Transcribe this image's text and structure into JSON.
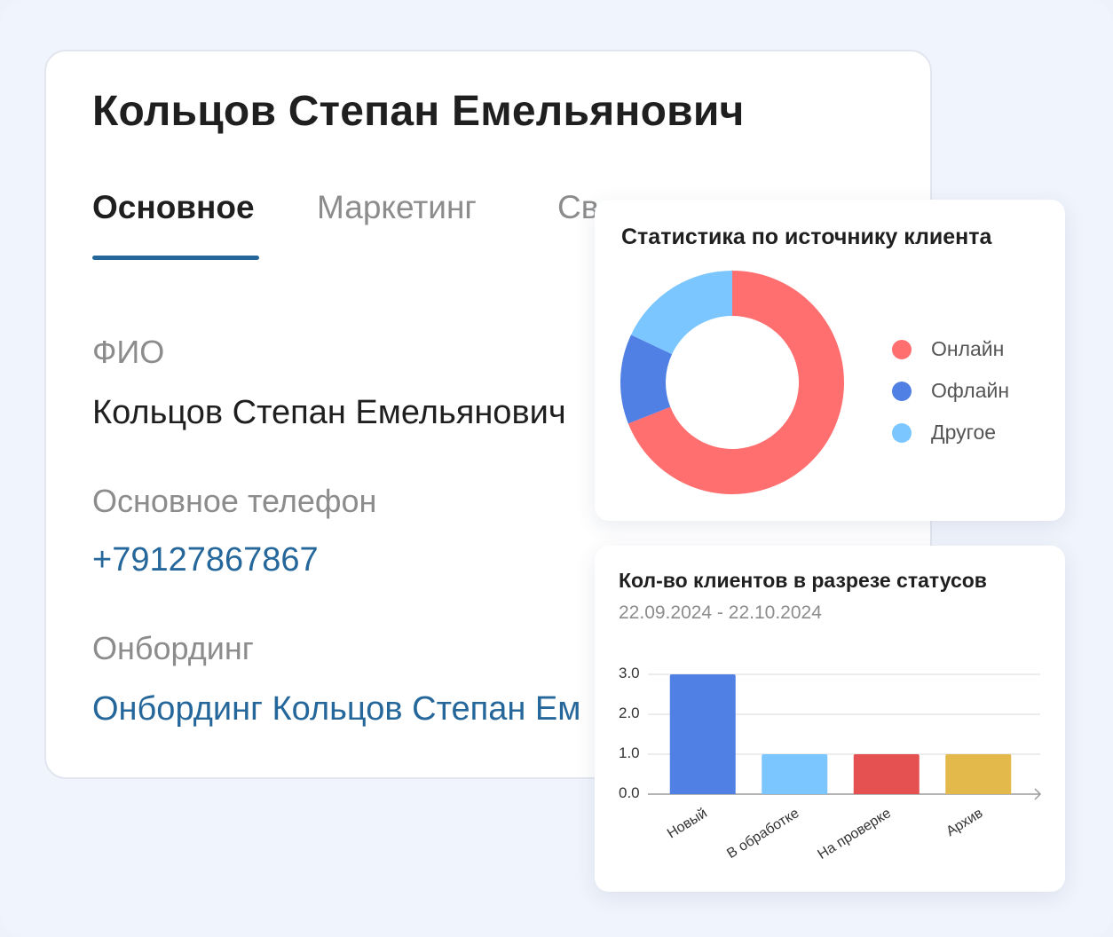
{
  "client": {
    "name": "Кольцов Степан Емельянович"
  },
  "tabs": [
    {
      "label": "Основное",
      "active": true
    },
    {
      "label": "Маркетинг",
      "active": false
    },
    {
      "label": "Св",
      "active": false
    }
  ],
  "fields": [
    {
      "label": "ФИО",
      "value": "Кольцов Степан Емельянович",
      "kind": "text"
    },
    {
      "label": "Основное телефон",
      "value": "+79127867867",
      "kind": "link"
    },
    {
      "label": "Онбординг",
      "value": "Онбординг Кольцов Степан Ем",
      "kind": "link"
    }
  ],
  "colors": {
    "accent": "#25679a",
    "red": "#ff6f6f",
    "blue": "#5080e4",
    "light_blue": "#7cc6ff",
    "dark_red": "#e55050",
    "yellow": "#e3b94c"
  },
  "donut_panel": {
    "title": "Статистика по источнику клиента",
    "chart_data": {
      "type": "pie",
      "donut": true,
      "labels": [
        "Онлайн",
        "Офлайн",
        "Другое"
      ],
      "values": [
        69,
        13,
        18
      ],
      "colors": [
        "#ff6f6f",
        "#5080e4",
        "#7cc6ff"
      ],
      "legend_position": "right"
    }
  },
  "bar_panel": {
    "title": "Кол-во клиентов в разрезе статусов",
    "subtitle": "22.09.2024 - 22.10.2024",
    "chart_data": {
      "type": "bar",
      "categories": [
        "Новый",
        "В обработке",
        "На проверке",
        "Архив"
      ],
      "values": [
        3,
        1,
        1,
        1
      ],
      "colors": [
        "#5080e4",
        "#7cc6ff",
        "#e55050",
        "#e3b94c"
      ],
      "ylim": [
        0,
        3
      ],
      "yticks": [
        "0.0",
        "1.0",
        "2.0",
        "3.0"
      ],
      "grid": true
    }
  }
}
